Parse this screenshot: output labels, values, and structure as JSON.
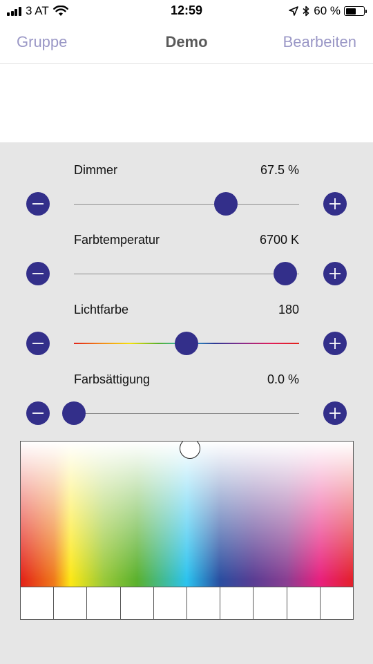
{
  "status_bar": {
    "carrier": "3 AT",
    "time": "12:59",
    "battery_percent": "60 %",
    "battery_level": 0.6,
    "icons": [
      "signal-icon",
      "wifi-icon",
      "location-arrow-icon",
      "bluetooth-icon",
      "battery-icon"
    ]
  },
  "nav": {
    "back_label": "Gruppe",
    "title": "Demo",
    "edit_label": "Bearbeiten"
  },
  "controls": [
    {
      "id": "dimmer",
      "label": "Dimmer",
      "value_text": "67.5 %",
      "position": 0.675,
      "track": "plain"
    },
    {
      "id": "farbtemperatur",
      "label": "Farbtemperatur",
      "value_text": "6700 K",
      "position": 0.94,
      "track": "plain"
    },
    {
      "id": "lichtfarbe",
      "label": "Lichtfarbe",
      "value_text": "180",
      "position": 0.5,
      "track": "rainbow"
    },
    {
      "id": "farbsaettigung",
      "label": "Farbsättigung",
      "value_text": "0.0 %",
      "position": 0.0,
      "track": "plain"
    }
  ],
  "buttons": {
    "minus_icon": "minus-icon",
    "plus_icon": "plus-icon"
  },
  "picker": {
    "selected_hue_fraction": 0.5,
    "selected_saturation_fraction": 0.0
  },
  "swatches": [
    "#ffffff",
    "#ffffff",
    "#ffffff",
    "#ffffff",
    "#ffffff",
    "#ffffff",
    "#ffffff",
    "#ffffff",
    "#ffffff",
    "#ffffff"
  ],
  "colors": {
    "accent": "#332f8a",
    "nav_link": "#9a97c6",
    "panel_background": "#e6e6e6"
  }
}
